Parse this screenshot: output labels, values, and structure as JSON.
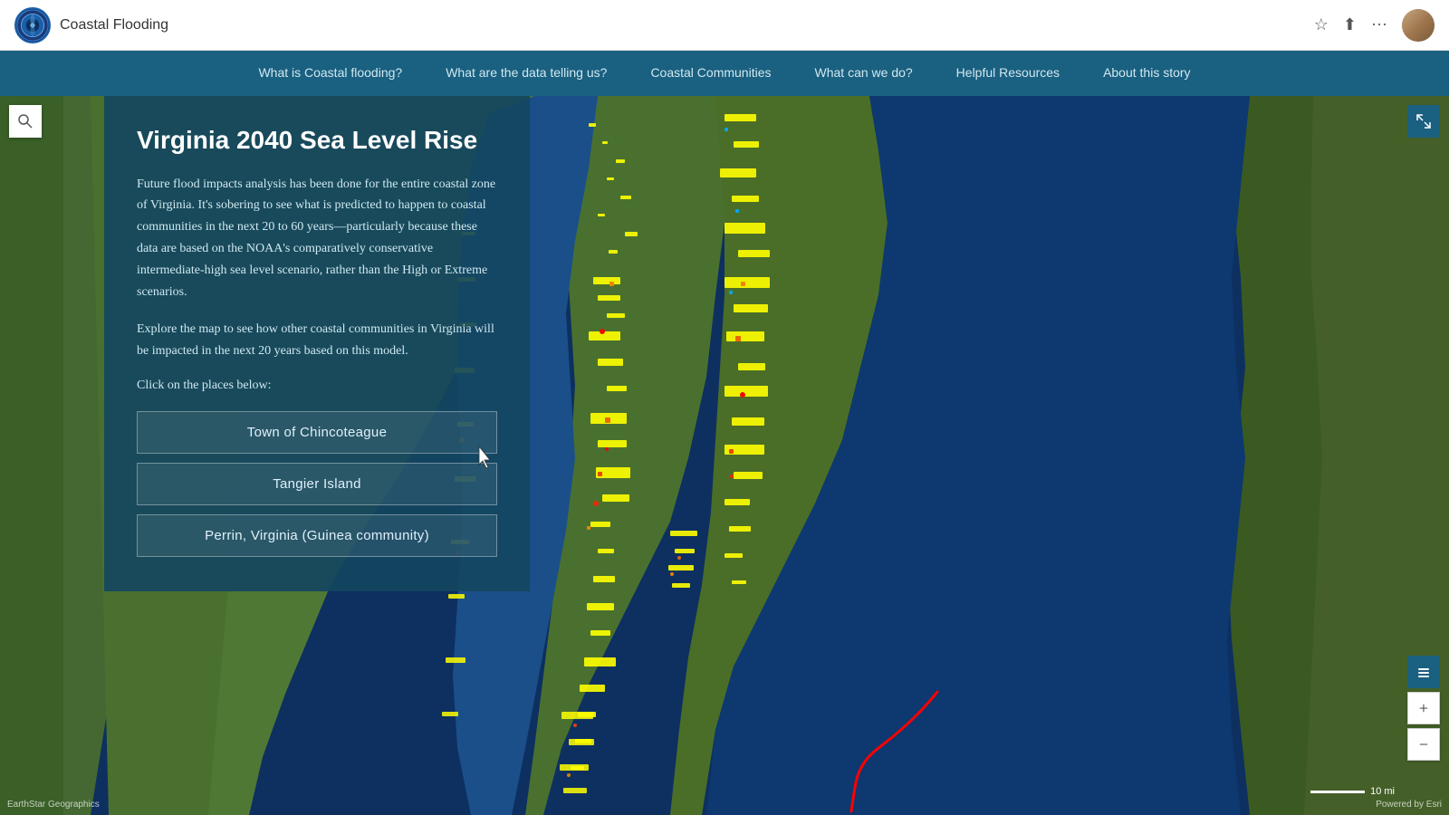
{
  "header": {
    "title": "Coastal Flooding",
    "logo_alt": "NOAA logo"
  },
  "navbar": {
    "items": [
      {
        "label": "What is Coastal flooding?"
      },
      {
        "label": "What are the data telling us?"
      },
      {
        "label": "Coastal Communities"
      },
      {
        "label": "What can we do?"
      },
      {
        "label": "Helpful Resources"
      },
      {
        "label": "About this story"
      }
    ]
  },
  "panel": {
    "title": "Virginia 2040 Sea Level Rise",
    "paragraph1": "Future flood impacts analysis has been done for the entire coastal zone of Virginia. It's sobering to see what is predicted to happen to coastal communities in the next 20 to 60 years—particularly because these data are based on the NOAA's comparatively conservative intermediate-high sea level scenario, rather than the High or Extreme scenarios.",
    "paragraph2": "Explore the map to see how other coastal communities in Virginia will be impacted in the next 20 years based on this model.",
    "cta": "Click on the places below:",
    "buttons": [
      {
        "label": "Town of Chincoteague"
      },
      {
        "label": "Tangier Island"
      },
      {
        "label": "Perrin, Virginia (Guinea community)"
      }
    ]
  },
  "map": {
    "search_icon": "🔍",
    "expand_icon": "⤢",
    "zoom_in": "+",
    "zoom_out": "−",
    "scale_label": "10 mi",
    "attribution": "Powered by Esri",
    "attribution_left": "EarthStar Geographics"
  }
}
